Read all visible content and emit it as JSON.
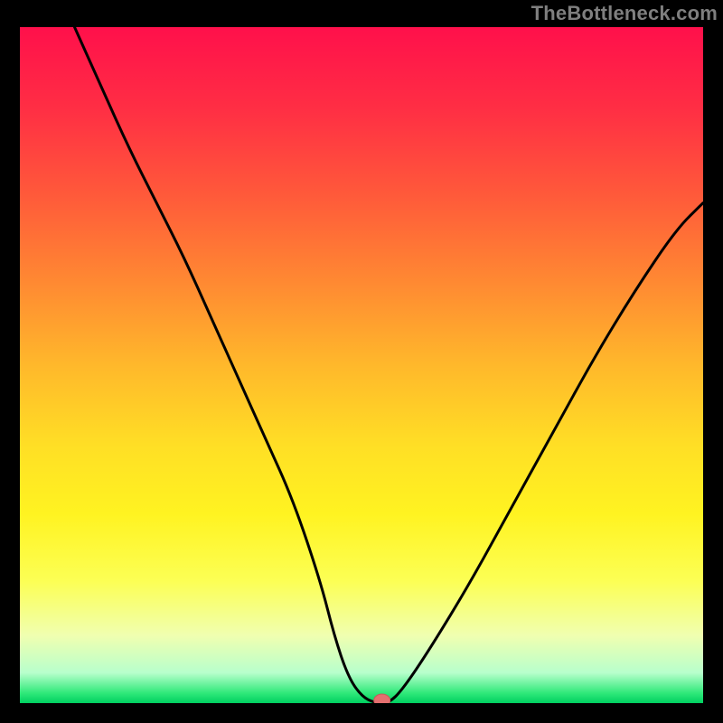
{
  "watermark": "TheBottleneck.com",
  "colors": {
    "gradient_stops": [
      {
        "offset": 0.0,
        "color": "#ff104b"
      },
      {
        "offset": 0.12,
        "color": "#ff2e44"
      },
      {
        "offset": 0.25,
        "color": "#ff5a3a"
      },
      {
        "offset": 0.38,
        "color": "#ff8a32"
      },
      {
        "offset": 0.5,
        "color": "#ffb82b"
      },
      {
        "offset": 0.62,
        "color": "#ffdf25"
      },
      {
        "offset": 0.72,
        "color": "#fff321"
      },
      {
        "offset": 0.82,
        "color": "#fcff55"
      },
      {
        "offset": 0.9,
        "color": "#f0ffb0"
      },
      {
        "offset": 0.955,
        "color": "#b8ffcc"
      },
      {
        "offset": 0.985,
        "color": "#30e97a"
      },
      {
        "offset": 1.0,
        "color": "#00d060"
      }
    ],
    "curve": "#000000",
    "marker_fill": "#e46f6f",
    "marker_stroke": "#c95a5a",
    "frame": "#000000"
  },
  "chart_data": {
    "type": "line",
    "title": "",
    "xlabel": "",
    "ylabel": "",
    "xlim": [
      0,
      100
    ],
    "ylim": [
      0,
      100
    ],
    "series": [
      {
        "name": "bottleneck-curve",
        "x": [
          8,
          12,
          16,
          20,
          24,
          28,
          32,
          36,
          40,
          44,
          46,
          48,
          50,
          52,
          54,
          56,
          60,
          66,
          72,
          78,
          84,
          90,
          96,
          100
        ],
        "y": [
          100,
          91,
          82,
          74,
          66,
          57,
          48,
          39,
          30,
          18,
          10,
          4,
          1,
          0,
          0,
          2,
          8,
          18,
          29,
          40,
          51,
          61,
          70,
          74
        ]
      }
    ],
    "annotations": [
      {
        "type": "marker",
        "x": 53,
        "y": 0,
        "label": "optimal-point"
      }
    ]
  }
}
